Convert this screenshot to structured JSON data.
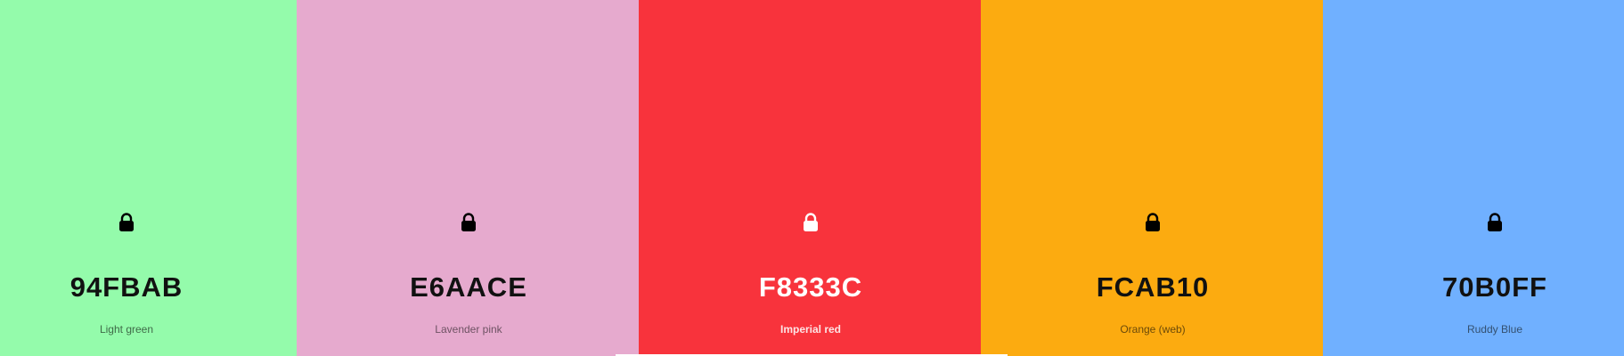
{
  "palette": {
    "colors": [
      {
        "hex": "94FBAB",
        "name": "Light green",
        "bg": "#94FBAB",
        "text_color": "#111111",
        "name_color": "#3f6b48",
        "lock_color": "#000000",
        "icon": "lock-icon"
      },
      {
        "hex": "E6AACE",
        "name": "Lavender pink",
        "bg": "#E6AACE",
        "text_color": "#111111",
        "name_color": "#6e5263",
        "lock_color": "#000000",
        "icon": "lock-icon"
      },
      {
        "hex": "F8333C",
        "name": "Imperial red",
        "bg": "#F8333C",
        "text_color": "#ffffff",
        "name_color": "#fde4e5",
        "lock_color": "#ffffff",
        "icon": "lock-icon"
      },
      {
        "hex": "FCAB10",
        "name": "Orange (web)",
        "bg": "#FCAB10",
        "text_color": "#111111",
        "name_color": "#6b4a0a",
        "lock_color": "#000000",
        "icon": "lock-icon"
      },
      {
        "hex": "70B0FF",
        "name": "Ruddy Blue",
        "bg": "#70B0FF",
        "text_color": "#111111",
        "name_color": "#34506f",
        "lock_color": "#000000",
        "icon": "lock-icon"
      }
    ]
  }
}
